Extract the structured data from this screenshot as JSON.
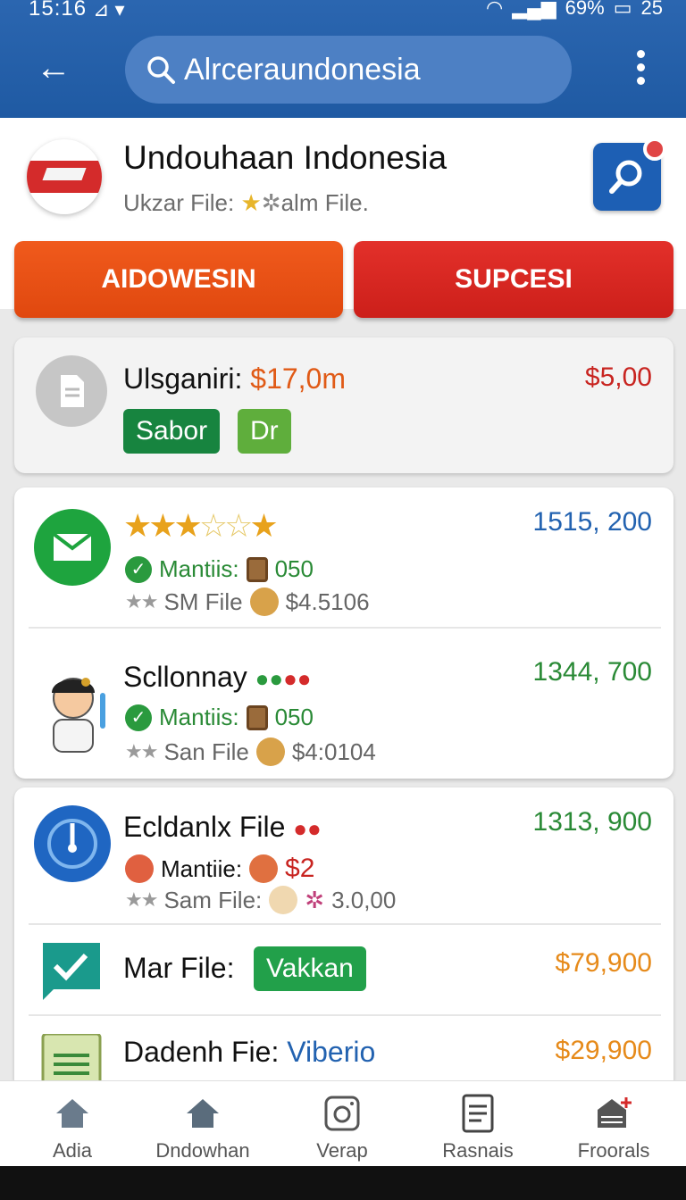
{
  "status_bar": {
    "time": "15:16",
    "battery": "69%",
    "extra": "25"
  },
  "search": {
    "query": "Alrceraundonesia"
  },
  "header": {
    "title": "Undouhaan Indonesia",
    "subtitle_prefix": "Ukzar File:",
    "subtitle_suffix": "alm File."
  },
  "buttons": {
    "left": "AIDOWESIN",
    "right": "SUPCESI"
  },
  "card1": {
    "title": "Ulsganiri:",
    "title_value": "$17,0m",
    "amount": "$5,00",
    "tags": [
      "Sabor",
      "Dr"
    ]
  },
  "card2": {
    "item1": {
      "rating": 3,
      "amount": "1515, 200",
      "line1_label": "Mantiis:",
      "line1_value": "050",
      "line2_label": "SM File",
      "line2_value": "$4.5106"
    },
    "item2": {
      "title": "Scllonnay",
      "amount": "1344, 700",
      "line1_label": "Mantiis:",
      "line1_value": "050",
      "line2_label": "San File",
      "line2_value": "$4:0104"
    }
  },
  "card3": {
    "item1": {
      "title": "Ecldanlx File",
      "amount": "1313, 900",
      "line1_label": "Mantiie:",
      "line1_value": "$2",
      "line2_label": "Sam File:",
      "line2_value": "3.0,00"
    },
    "item2": {
      "title": "Mar File:",
      "tag": "Vakkan",
      "amount": "$79,900"
    },
    "item3": {
      "title": "Dadenh Fie:",
      "title_value": "Viberio",
      "amount": "$29,900"
    }
  },
  "nav": [
    {
      "label": "Adia",
      "icon": "home-icon"
    },
    {
      "label": "Dndowhan",
      "icon": "home-icon"
    },
    {
      "label": "Verap",
      "icon": "camera-icon"
    },
    {
      "label": "Rasnais",
      "icon": "document-icon"
    },
    {
      "label": "Froorals",
      "icon": "bookmark-add-icon"
    }
  ],
  "colors": {
    "appbar": "#1f5aa3",
    "orange": "#e0480f",
    "red": "#cc1f1a",
    "green": "#2a8a36",
    "blue": "#1d5fb4"
  }
}
